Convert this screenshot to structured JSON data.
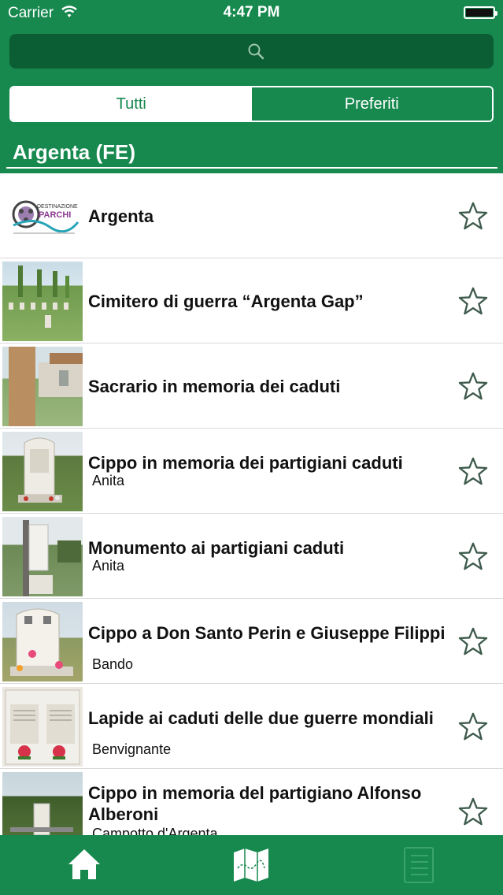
{
  "status": {
    "carrier": "Carrier",
    "time": "4:47 PM",
    "wifi_icon": "wifi-icon",
    "battery_icon": "battery-icon"
  },
  "search": {
    "icon": "search-icon",
    "placeholder": ""
  },
  "segments": [
    {
      "label": "Tutti",
      "selected": true
    },
    {
      "label": "Preferiti",
      "selected": false
    }
  ],
  "section": {
    "title": "Argenta (FE)"
  },
  "items": [
    {
      "title": "Argenta",
      "subtitle": "",
      "favorite": false
    },
    {
      "title": "Cimitero di guerra “Argenta Gap”",
      "subtitle": "",
      "favorite": false
    },
    {
      "title": "Sacrario in memoria dei caduti",
      "subtitle": "",
      "favorite": false
    },
    {
      "title": "Cippo in memoria dei partigiani caduti",
      "subtitle": "Anita",
      "favorite": false
    },
    {
      "title": "Monumento ai partigiani caduti",
      "subtitle": "Anita",
      "favorite": false
    },
    {
      "title": "Cippo a Don Santo Perin e Giuseppe Filippi",
      "subtitle": "Bando",
      "favorite": false
    },
    {
      "title": "Lapide ai caduti delle due guerre mondiali",
      "subtitle": "Benvignante",
      "favorite": false
    },
    {
      "title": "Cippo in memoria del partigiano Alfonso Alberoni",
      "subtitle": "Campotto d'Argenta",
      "favorite": false
    }
  ],
  "logo": {
    "line1": "DESTINAZIONE",
    "line2": "PARCHI"
  },
  "tabbar": [
    {
      "icon": "home-icon"
    },
    {
      "icon": "map-icon"
    },
    {
      "icon": "list-icon"
    }
  ],
  "colors": {
    "primary": "#17894f",
    "search_bg": "#0b5e33",
    "star": "#3d5a4b"
  }
}
